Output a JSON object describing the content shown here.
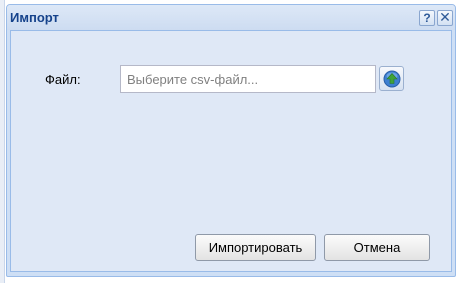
{
  "dialog": {
    "title": "Импорт",
    "help_icon": "help-icon",
    "close_icon": "close-icon",
    "help_glyph": "?",
    "close_glyph": "✕"
  },
  "form": {
    "file_label": "Файл:",
    "file_placeholder": "Выберите csv-файл...",
    "file_value": "",
    "browse_icon": "upload-icon"
  },
  "buttons": {
    "import_label": "Импортировать",
    "cancel_label": "Отмена"
  },
  "colors": {
    "title_text": "#15428b",
    "frame": "#99bbe8",
    "body_bg": "#dfe8f6",
    "browse_icon_green": "#3fa33a",
    "browse_icon_blue": "#3d7fd1"
  }
}
